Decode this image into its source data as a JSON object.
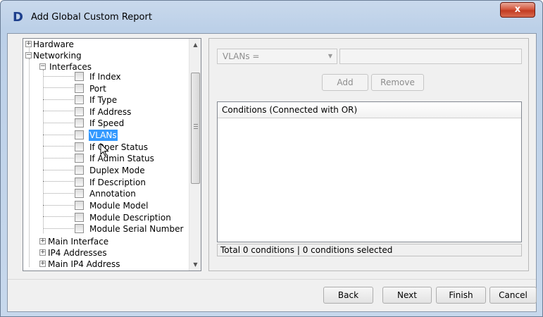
{
  "window": {
    "title": "Add Global Custom Report",
    "close_label": "x",
    "logo_letter": "D"
  },
  "tree": {
    "nodes": [
      {
        "label": "Hardware",
        "expander": "+"
      },
      {
        "label": "Networking",
        "expander": "−"
      },
      {
        "label": "Interfaces",
        "expander": "−"
      },
      {
        "label": "If Index"
      },
      {
        "label": "Port"
      },
      {
        "label": "If Type"
      },
      {
        "label": "If Address"
      },
      {
        "label": "If Speed"
      },
      {
        "label": "VLANs",
        "selected": true
      },
      {
        "label": "If Oper Status"
      },
      {
        "label": "If Admin Status"
      },
      {
        "label": "Duplex Mode"
      },
      {
        "label": "If Description"
      },
      {
        "label": "Annotation"
      },
      {
        "label": "Module Model"
      },
      {
        "label": "Module Description"
      },
      {
        "label": "Module Serial Number"
      },
      {
        "label": "Main Interface",
        "expander": "+"
      },
      {
        "label": "IP4 Addresses",
        "expander": "+"
      },
      {
        "label": "Main IP4 Address",
        "expander": "+"
      }
    ]
  },
  "filter": {
    "field_value": "VLANs =",
    "value": ""
  },
  "buttons": {
    "add": "Add",
    "remove": "Remove",
    "back": "Back",
    "next": "Next",
    "finish": "Finish",
    "cancel": "Cancel"
  },
  "conditions": {
    "header": "Conditions (Connected with OR)",
    "status": "Total 0 conditions | 0 conditions selected"
  }
}
